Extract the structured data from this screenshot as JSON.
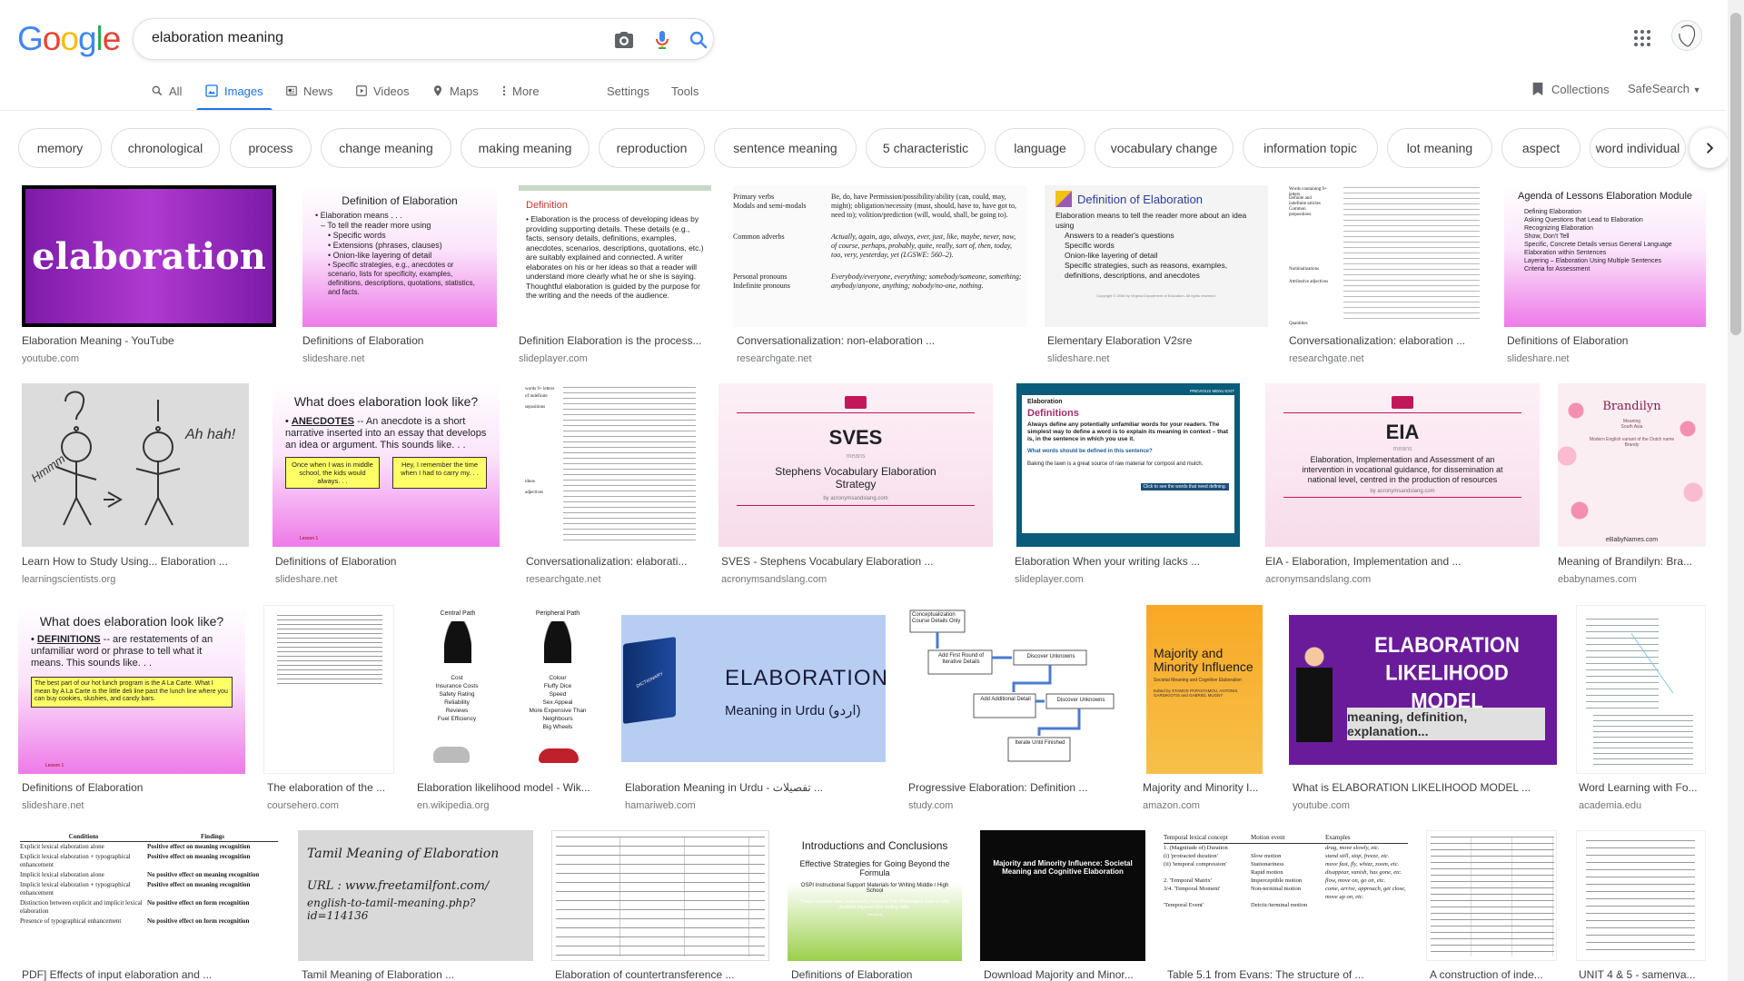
{
  "logo": {
    "letters": [
      "G",
      "o",
      "o",
      "g",
      "l",
      "e"
    ],
    "colors": [
      "#4285f4",
      "#ea4335",
      "#fbbc05",
      "#4285f4",
      "#34a853",
      "#ea4335"
    ]
  },
  "search": {
    "query": "elaboration meaning"
  },
  "icons": {
    "camera": "camera-icon",
    "mic": "microphone-icon",
    "search": "search-icon",
    "apps": "apps-grid-icon"
  },
  "tabs": [
    {
      "label": "All",
      "icon": "search-icon"
    },
    {
      "label": "Images",
      "icon": "image-icon"
    },
    {
      "label": "News",
      "icon": "news-icon"
    },
    {
      "label": "Videos",
      "icon": "video-icon"
    },
    {
      "label": "Maps",
      "icon": "map-pin-icon"
    },
    {
      "label": "More",
      "icon": "more-vert-icon"
    }
  ],
  "tools": {
    "settings": "Settings",
    "tools": "Tools",
    "collections": "Collections",
    "safesearch": "SafeSearch"
  },
  "chips": [
    "memory",
    "chronological",
    "process",
    "change meaning",
    "making meaning",
    "reproduction",
    "sentence meaning",
    "5 characteristic",
    "language",
    "vocabulary change",
    "information topic",
    "lot meaning",
    "aspect",
    "word individual"
  ],
  "results": [
    {
      "title": "Elaboration Meaning - YouTube",
      "source": "youtube.com"
    },
    {
      "title": "Definitions of Elaboration",
      "source": "slideshare.net"
    },
    {
      "title": "Definition Elaboration is the process...",
      "source": "slideplayer.com"
    },
    {
      "title": "Conversationalization: non-elaboration ...",
      "source": "researchgate.net"
    },
    {
      "title": "Elementary Elaboration V2sre",
      "source": "slideshare.net"
    },
    {
      "title": "Conversationalization: elaboration ...",
      "source": "researchgate.net"
    },
    {
      "title": "Definitions of Elaboration",
      "source": "slideshare.net"
    },
    {
      "title": "Learn How to Study Using... Elaboration ...",
      "source": "learningscientists.org"
    },
    {
      "title": "Definitions of Elaboration",
      "source": "slideshare.net"
    },
    {
      "title": "Conversationalization: elaborati...",
      "source": "researchgate.net"
    },
    {
      "title": "SVES - Stephens Vocabulary Elaboration ...",
      "source": "acronymsandslang.com"
    },
    {
      "title": "Elaboration When your writing lacks ...",
      "source": "slideplayer.com"
    },
    {
      "title": "EIA - Elaboration, Implementation and ...",
      "source": "acronymsandslang.com"
    },
    {
      "title": "Meaning of Brandilyn: Bra...",
      "source": "ebabynames.com"
    },
    {
      "title": "Definitions of Elaboration",
      "source": "slideshare.net"
    },
    {
      "title": "The elaboration of the ...",
      "source": "coursehero.com"
    },
    {
      "title": "Elaboration likelihood model - Wik...",
      "source": "en.wikipedia.org"
    },
    {
      "title": "Elaboration Meaning in Urdu - تفصیلات ...",
      "source": "hamariweb.com"
    },
    {
      "title": "Progressive Elaboration: Definition ...",
      "source": "study.com"
    },
    {
      "title": "Majority and Minority I...",
      "source": "amazon.com"
    },
    {
      "title": "What is ELABORATION LIKELIHOOD MODEL ...",
      "source": "youtube.com"
    },
    {
      "title": "Word Learning with Fo...",
      "source": "academia.edu"
    },
    {
      "title": "PDF] Effects of input elaboration and ...",
      "source": ""
    },
    {
      "title": "Tamil Meaning of Elaboration ...",
      "source": ""
    },
    {
      "title": "Elaboration of countertransference ...",
      "source": ""
    },
    {
      "title": "Definitions of Elaboration",
      "source": ""
    },
    {
      "title": "Download Majority and Minor...",
      "source": ""
    },
    {
      "title": "Table 5.1 from Evans: The structure of ...",
      "source": ""
    },
    {
      "title": "A construction of inde...",
      "source": ""
    },
    {
      "title": "UNIT 4 & 5 - samenva...",
      "source": ""
    }
  ],
  "thumbs": {
    "t0": {
      "text": "elaboration"
    },
    "t1": {
      "title": "Definition of Elaboration",
      "lines": [
        "• Elaboration means . . .",
        "– To tell the reader more using",
        "• Specific words",
        "• Extensions (phrases, clauses)",
        "• Onion-like layering of detail",
        "• Specific strategies, e.g., anecdotes or scenario, lists for specificity, examples, definitions, descriptions, quotations, statistics, and facts."
      ]
    },
    "t2": {
      "title": "Definition",
      "body": "• Elaboration is the process of developing ideas by providing supporting details. These details (e.g., facts, sensory details, definitions, examples, anecdotes, scenarios, descriptions, quotations, etc.) are suitably explained and connected. A writer elaborates on his or her ideas so that a reader will understand more clearly what he or she is saying. Thoughtful elaboration is guided by the purpose for the writing and the needs of the audience."
    },
    "t3": {
      "rows": [
        {
          "k": "Primary verbs\nModals and semi-modals",
          "v": "Be, do, have\nPermission/possibility/ability (can, could, may, might); obligation/necessity (must, should, have to, have got to, need to); volition/prediction (will, would, shall, be going to)."
        },
        {
          "k": "Common adverbs",
          "v": "Actually, again, ago, always, ever, just, like, maybe, never, now, of course, perhaps, probably, quite, really, sort of, then, today, too, very, yesterday, yet (LGSWE: 560–2)."
        },
        {
          "k": "Personal pronouns\nIndefinite pronouns",
          "v": "Everybody/everyone, everything; somebody/someone, something; anybody/anyone, anything; nobody/no-one, nothing."
        }
      ]
    },
    "t4": {
      "title": "Definition of Elaboration",
      "intro": "Elaboration means to tell the reader more about an idea using",
      "lines": [
        "Answers to a reader's questions",
        "Specific words",
        "Onion-like layering of detail",
        "Specific strategies, such as reasons, examples, definitions, descriptions, and anecdotes"
      ],
      "footer": "Copyright © 2006 by Virginia Department of Education. All rights reserved."
    },
    "t5": {
      "labels": [
        "Words containing 9+ letters",
        "Definite and indefinite articles",
        "Common prepositions",
        "Nominalizations",
        "Attributive adjectives",
        "Quantities"
      ]
    },
    "t6": {
      "title": "Agenda of Lessons Elaboration Module",
      "lines": [
        "Defining Elaboration",
        "Asking Questions that Lead to Elaboration",
        "Recognizing Elaboration",
        "Show, Don't Tell",
        "Specific, Concrete Details versus General Language",
        "Elaboration within Sentences",
        "Layering – Elaboration Using Multiple Sentences",
        "Criteria for Assessment"
      ]
    },
    "t7": {
      "left": "Hmmm",
      "right": "Ah hah!"
    },
    "t8": {
      "title": "What does elaboration look like?",
      "term": "ANECDOTES",
      "def": "-- An anecdote is a short narrative inserted into an essay that develops an idea or argument. This sounds like. . .",
      "b1": "Once when I was in middle school, the kids would always. . .",
      "b2": "Hey, I remember the time when I had to carry my. . .",
      "footer": "Lesson 1"
    },
    "t9": {
      "labels": [
        "words 9+ letters",
        "of indefinite",
        "sepositions",
        "iduns",
        "adjectives"
      ]
    },
    "t10": {
      "title": "SVES",
      "sub": "means",
      "full": "Stephens Vocabulary Elaboration Strategy",
      "footer": "by acronymsandslang.com"
    },
    "t11": {
      "nav": "PREVIOUS  MENU  EXIT",
      "head": "Elaboration",
      "title": "Definitions",
      "body": "Always define any potentially unfamiliar words for your readers. The simplest way to define a word is to explain its meaning in context – that is, in the sentence in which you use it.",
      "q": "What words should be defined in this sentence?",
      "s": "Baking the lawn is a great source of raw material for compost and mulch.",
      "footer": "Click to see the words that need defining."
    },
    "t12": {
      "title": "EIA",
      "sub": "means",
      "full": "Elaboration, Implementation and Assessment of an intervention in vocational guidance, for dissemination at national level, centred in the production of resources",
      "footer": "by acronymsandslang.com"
    },
    "t13": {
      "title": "Brandilyn",
      "meaning": "Meaning",
      "origin": "South Asia",
      "extra": "Modern English variant of the Dutch name Brandy",
      "footer": "eBabyNames.com"
    },
    "t14": {
      "title": "What does elaboration look like?",
      "term": "DEFINITIONS",
      "def": "-- are restatements of an unfamiliar word or phrase to tell what it means. This sounds like. . .",
      "box": "The best part of our hot lunch program is the A La Carte. What I mean by A La Carte is the little deli line past the lunch line where you can buy cookies, slushies, and candy bars.",
      "footer": "Lesson 1"
    },
    "t16": {
      "left": "Central Path",
      "right": "Peripheral Path",
      "l": [
        "Cost",
        "Insurance Costs",
        "Safety Rating",
        "Reliability",
        "Reviews",
        "Fuel Efficiency"
      ],
      "r": [
        "Colour",
        "Fluffy Dice",
        "Speed",
        "Sex Appeal",
        "More Expensive Than Neighbours",
        "Big Wheels"
      ]
    },
    "t17": {
      "book": "DICTIONARY",
      "title": "ELABORATION",
      "sub": "Meaning in Urdu (اردو)"
    },
    "t18": {
      "boxes": [
        "Conceptualization Course Details Only",
        "Add First Round of Iterative Details",
        "Discover Unknowns",
        "Add Additional Detail",
        "Discover Unknowns",
        "Iterate Until Finished"
      ]
    },
    "t19": {
      "title": "Majority and Minority Influence",
      "sub": "Societal Meaning and Cognitive Elaboration",
      "authors": "Edited by STAMOS PAPASTAMOU, ANTONIS GARDIKIOTIS and GABRIEL MUGNY"
    },
    "t20": {
      "l1": "ELABORATION",
      "l2": "LIKELIHOOD MODEL",
      "sub": "meaning, definition, explanation..."
    },
    "t22": {
      "head": [
        "Conditions",
        "Findings"
      ],
      "rows": [
        [
          "Explicit lexical elaboration alone",
          "Positive effect on meaning recognition"
        ],
        [
          "Explicit lexical elaboration + typographical enhancement",
          "Positive effect on meaning recognition"
        ],
        [
          "Implicit lexical elaboration alone",
          "No positive effect on meaning recognition"
        ],
        [
          "Implicit lexical elaboration + typographical enhancement",
          "Positive effect on meaning recognition"
        ],
        [
          "Distinction between explicit and implicit lexical elaboration",
          "No positive effect on form recognition"
        ],
        [
          "Presence of typographical enhancement",
          "No positive effect on form recognition"
        ]
      ]
    },
    "t23": {
      "title": "Tamil Meaning of Elaboration",
      "url1": "URL : www.freetamilfont.com/",
      "url2": "english-to-tamil-meaning.php?id=114136"
    },
    "t25": {
      "title": "Introductions and Conclusions",
      "sub": "Effective Strategies for Going Beyond the Formula",
      "org": "OSPI Instructional Support Materials for Writing Middle / High School",
      "body": "These materials were prepared by teachers from Washington state to help students improve their writing skills.",
      "ver": "Version 6"
    },
    "t26": {
      "title": "Majority and Minority Influence: Societal Meaning and Cognitive Elaboration"
    },
    "t27": {
      "head": [
        "Temporal lexical concept",
        "Motion event",
        "Examples"
      ],
      "rows": [
        [
          "1. (Magnitude of) Duration",
          "",
          "drag, move slowly, etc."
        ],
        [
          "(i) 'protracted duration'",
          "Slow motion",
          "stand still, stop, freeze, etc."
        ],
        [
          "(ii) 'temporal compression'",
          "Stationariness",
          "move fast, fly, whizz, zoom, etc."
        ],
        [
          "",
          "Rapid motion",
          "disappear, vanish, has gone, etc."
        ],
        [
          "2. 'Temporal Matrix'",
          "Imperceptible motion",
          "flow, move on, go on, etc."
        ],
        [
          "3/4. 'Temporal Moment'",
          "Non-terminal motion",
          "come, arrive, approach, get close, move up on, etc."
        ],
        [
          "'Temporal Event'",
          "Deictic/terminal motion",
          ""
        ]
      ]
    }
  },
  "colors": {
    "blue": "#1a73e8",
    "purple": "#9b1fcb",
    "pink": "#ee7ae9"
  }
}
